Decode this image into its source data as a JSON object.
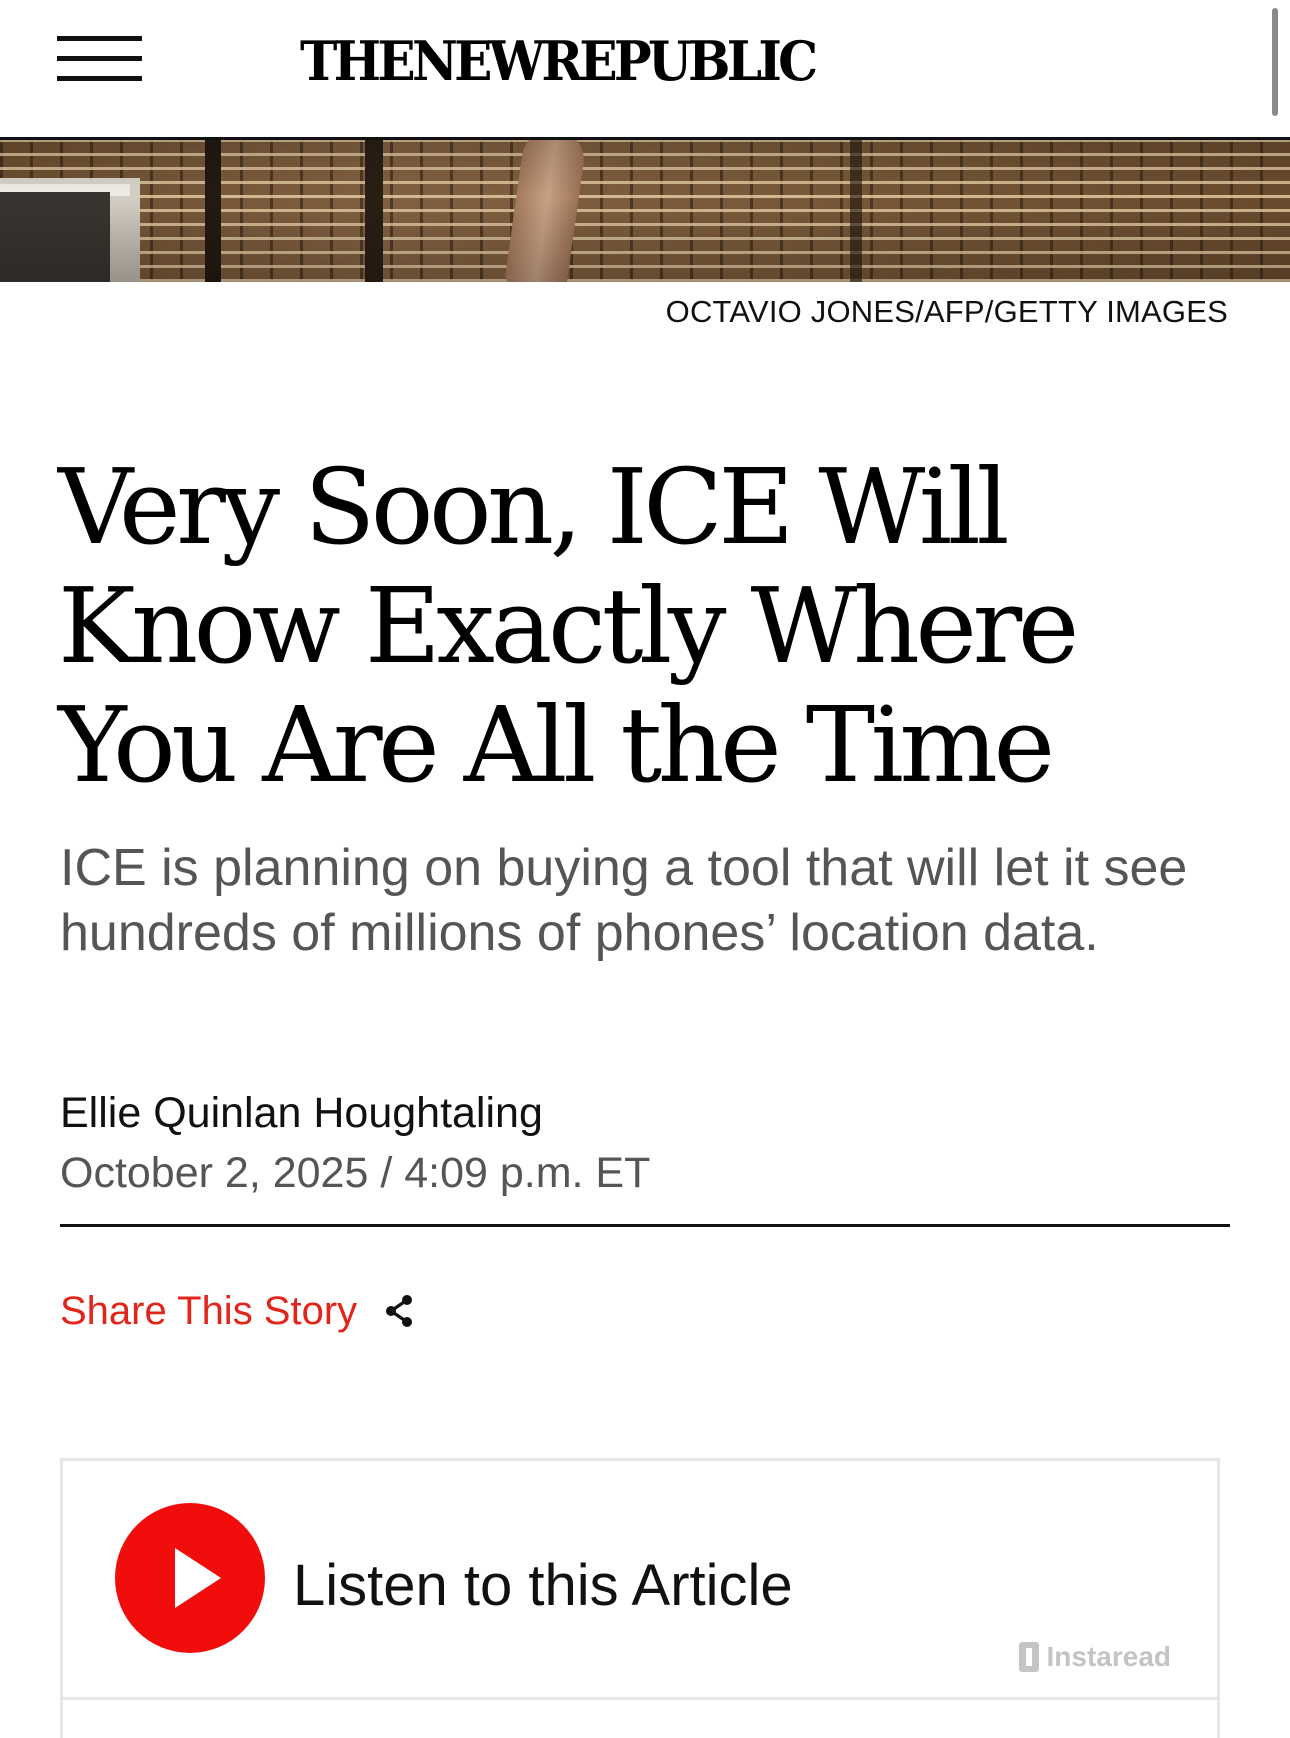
{
  "header": {
    "logo_text": "THENEWREPUBLIC",
    "menu_icon": "hamburger-menu-icon"
  },
  "hero": {
    "photo_credit": "OCTAVIO JONES/AFP/GETTY IMAGES"
  },
  "article": {
    "headline": "Very Soon, ICE Will Know Exactly Where You Are All the Time",
    "dek": "ICE is planning on buying a tool that will let it see hundreds of millions of phones’ location data.",
    "author": "Ellie Quinlan Houghtaling",
    "dateline": "October 2, 2025 / 4:09 p.m. ET"
  },
  "share": {
    "label": "Share This Story",
    "icon": "share-icon"
  },
  "listen": {
    "label": "Listen to this Article",
    "provider": "Instaread",
    "play_icon": "play-icon"
  },
  "colors": {
    "accent_red": "#e1251b",
    "play_red": "#f20d0d",
    "text": "#111111",
    "muted_text": "#555555"
  }
}
